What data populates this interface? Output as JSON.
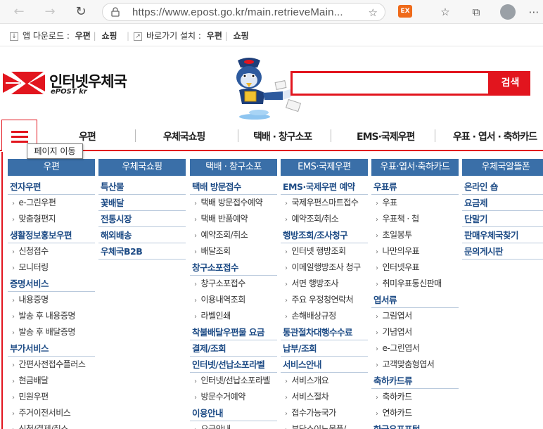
{
  "browser": {
    "url": "https://www.epost.go.kr/main.retrieveMain...",
    "ext_label": "EX"
  },
  "infobar": {
    "app_download_label": "앱 다운로드 :",
    "app_download_links": [
      "우편",
      "쇼핑"
    ],
    "shortcut_label": "바로가기 설치 :",
    "shortcut_links": [
      "우편",
      "쇼핑"
    ]
  },
  "header": {
    "logo_title": "인터넷우체국",
    "logo_sub": "ePOST kr",
    "search_placeholder": "",
    "search_button": "검색"
  },
  "gnb": {
    "items": [
      "우편",
      "우체국쇼핑",
      "택배 · 창구소포",
      "EMS·국제우편",
      "우표 · 엽서 · 축하카드"
    ],
    "tooltip": "페이지 이동"
  },
  "mega": {
    "columns": [
      {
        "title": "우편",
        "rows": [
          {
            "t": "cat",
            "label": "전자우편"
          },
          {
            "t": "sub",
            "label": "e-그린우편"
          },
          {
            "t": "sub",
            "label": "맞춤형편지"
          },
          {
            "t": "cat",
            "label": "생활정보홍보우편"
          },
          {
            "t": "sub",
            "label": "신청접수"
          },
          {
            "t": "sub",
            "label": "모니터링"
          },
          {
            "t": "cat",
            "label": "증명서비스"
          },
          {
            "t": "sub",
            "label": "내용증명"
          },
          {
            "t": "sub",
            "label": "발송 후 내용증명"
          },
          {
            "t": "sub",
            "label": "발송 후 배달증명"
          },
          {
            "t": "cat",
            "label": "부가서비스"
          },
          {
            "t": "sub",
            "label": "간편사전접수플러스"
          },
          {
            "t": "sub",
            "label": "현금배달"
          },
          {
            "t": "sub",
            "label": "민원우편"
          },
          {
            "t": "sub",
            "label": "주거이전서비스"
          },
          {
            "t": "sub",
            "label": "신청/결제/취소"
          }
        ]
      },
      {
        "title": "우체국쇼핑",
        "rows": [
          {
            "t": "cat",
            "label": "특산물"
          },
          {
            "t": "cat",
            "label": "꽃배달"
          },
          {
            "t": "cat",
            "label": "전통시장"
          },
          {
            "t": "cat",
            "label": "해외배송"
          },
          {
            "t": "cat",
            "label": "우체국B2B"
          }
        ]
      },
      {
        "title": "택배 · 창구소포",
        "rows": [
          {
            "t": "cat",
            "label": "택배 방문접수"
          },
          {
            "t": "sub",
            "label": "택배 방문접수예약"
          },
          {
            "t": "sub",
            "label": "택배 반품예약"
          },
          {
            "t": "sub",
            "label": "예약조회/취소"
          },
          {
            "t": "sub",
            "label": "배달조회"
          },
          {
            "t": "cat",
            "label": "창구소포접수"
          },
          {
            "t": "sub",
            "label": "창구소포접수"
          },
          {
            "t": "sub",
            "label": "이용내역조회"
          },
          {
            "t": "sub",
            "label": "라벨인쇄"
          },
          {
            "t": "cat",
            "label": "착불배달우편물 요금"
          },
          {
            "t": "cat",
            "label": "결제/조회"
          },
          {
            "t": "cat",
            "label": "인터넷/선납소포라벨"
          },
          {
            "t": "sub",
            "label": "인터넷/선납소포라벨"
          },
          {
            "t": "sub",
            "label": "방문수거예약"
          },
          {
            "t": "cat",
            "label": "이용안내"
          },
          {
            "t": "sub",
            "label": "요금안내"
          }
        ]
      },
      {
        "title": "EMS·국제우편",
        "rows": [
          {
            "t": "cat",
            "label": "EMS·국제우편 예약"
          },
          {
            "t": "sub",
            "label": "국제우편스마트접수"
          },
          {
            "t": "sub",
            "label": "예약조회/취소"
          },
          {
            "t": "cat",
            "label": "행방조회/조사청구"
          },
          {
            "t": "sub",
            "label": "인터넷 행방조회"
          },
          {
            "t": "sub",
            "label": "이메일행방조사 청구"
          },
          {
            "t": "sub",
            "label": "서면 행방조사"
          },
          {
            "t": "sub",
            "label": "주요 우정청연락처"
          },
          {
            "t": "sub",
            "label": "손해배상규정"
          },
          {
            "t": "cat",
            "label": "통관절차대행수수료"
          },
          {
            "t": "cat",
            "label": "납부/조회"
          },
          {
            "t": "cat",
            "label": "서비스안내"
          },
          {
            "t": "sub",
            "label": "서비스개요"
          },
          {
            "t": "sub",
            "label": "서비스절차"
          },
          {
            "t": "sub",
            "label": "접수가능국가"
          },
          {
            "t": "sub",
            "label": "부당소이노물품/"
          }
        ]
      },
      {
        "title": "우표·엽서·축하카드",
        "rows": [
          {
            "t": "cat",
            "label": "우표류"
          },
          {
            "t": "sub",
            "label": "우표"
          },
          {
            "t": "sub",
            "label": "우표책 · 첩"
          },
          {
            "t": "sub",
            "label": "초일봉투"
          },
          {
            "t": "sub",
            "label": "나만의우표"
          },
          {
            "t": "sub",
            "label": "인터넷우표"
          },
          {
            "t": "sub",
            "label": "취미우표통신판매"
          },
          {
            "t": "cat",
            "label": "엽서류"
          },
          {
            "t": "sub",
            "label": "그림엽서"
          },
          {
            "t": "sub",
            "label": "기념엽서"
          },
          {
            "t": "sub",
            "label": "e-그린엽서"
          },
          {
            "t": "sub",
            "label": "고객맞춤형엽서"
          },
          {
            "t": "cat",
            "label": "축하카드류"
          },
          {
            "t": "sub",
            "label": "축하카드"
          },
          {
            "t": "sub",
            "label": "연하카드"
          },
          {
            "t": "cat",
            "label": "한국우표포털"
          }
        ]
      },
      {
        "title": "우체국알뜰폰",
        "rows": [
          {
            "t": "cat",
            "label": "온라인 숍"
          },
          {
            "t": "cat",
            "label": "요금제"
          },
          {
            "t": "cat",
            "label": "단말기"
          },
          {
            "t": "cat",
            "label": "판매우체국찾기"
          },
          {
            "t": "cat",
            "label": "문의게시판"
          }
        ]
      }
    ]
  }
}
